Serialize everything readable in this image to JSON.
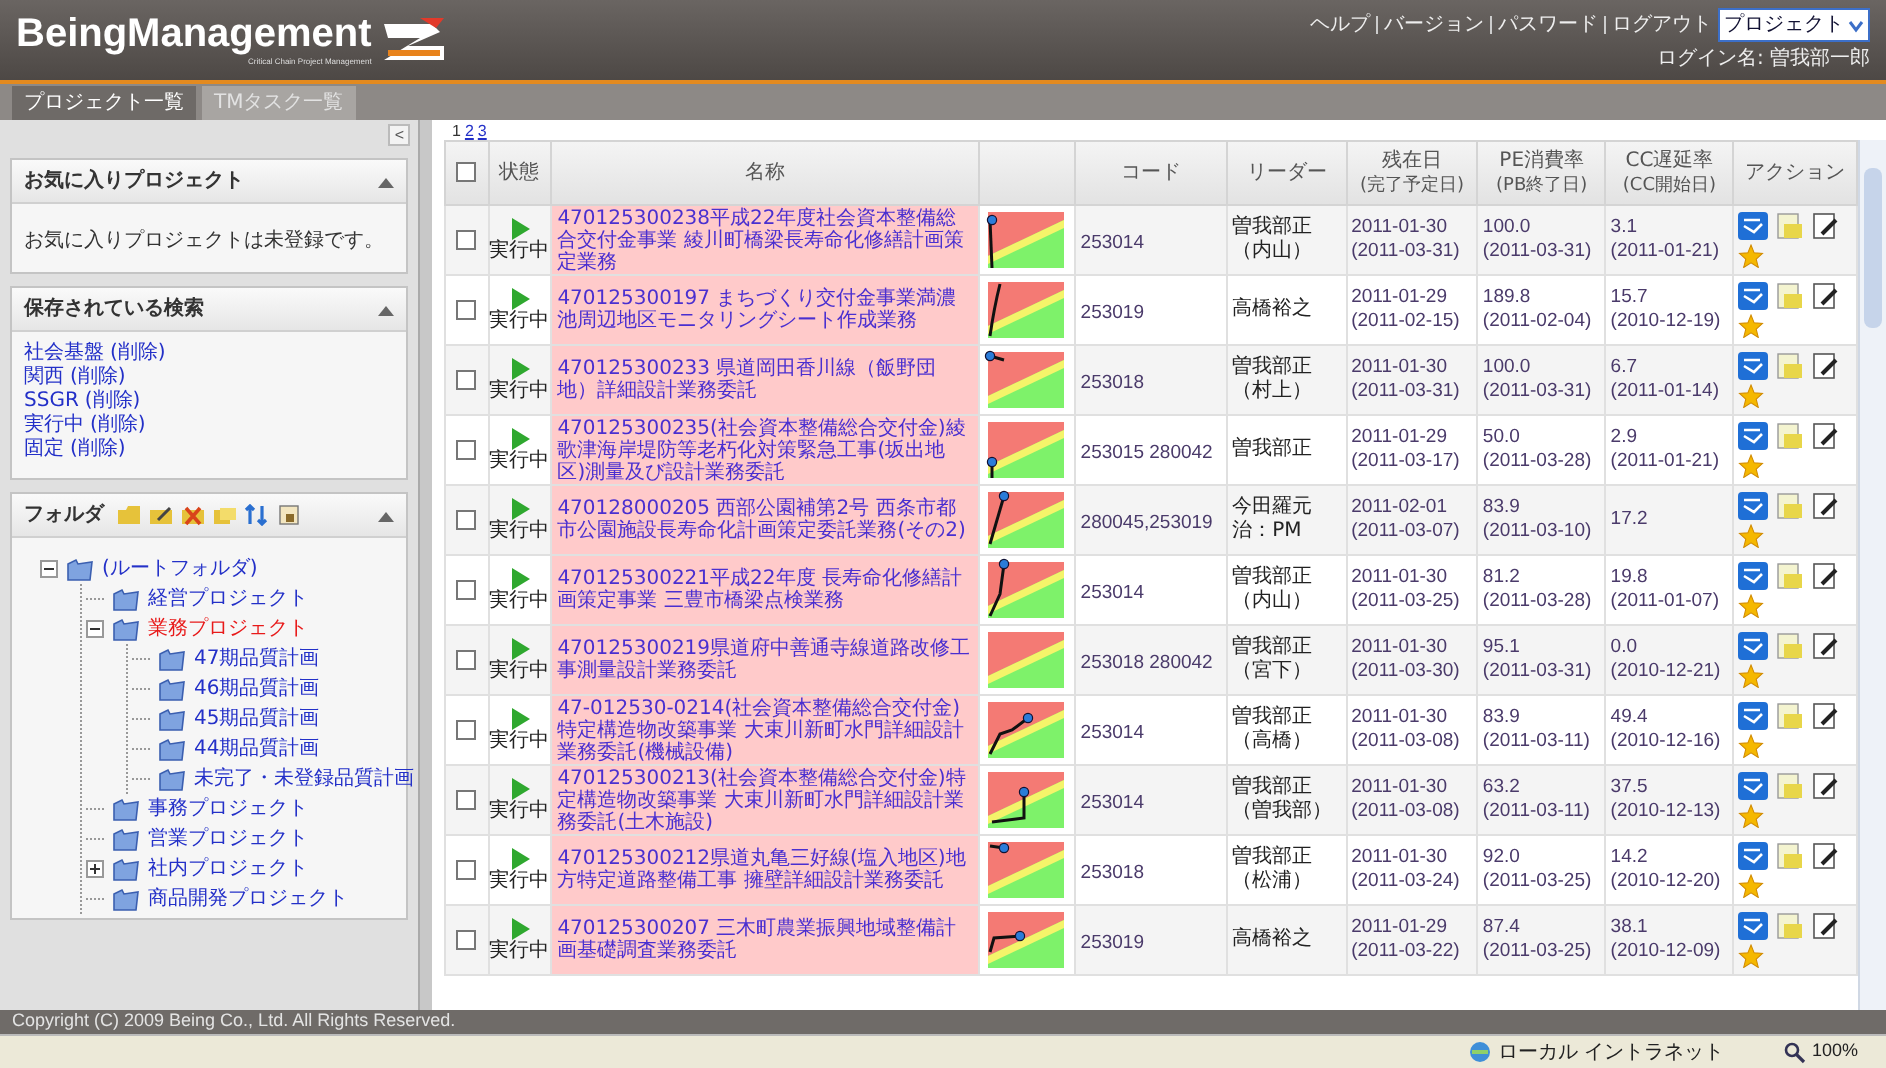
{
  "header": {
    "logo": "BeingManagement",
    "logo_subtitle": "Critical Chain Project Management",
    "links": [
      "ヘルプ",
      "バージョン",
      "パスワード",
      "ログアウト"
    ],
    "project_select": "プロジェクト",
    "login": "ログイン名: 曽我部一郎"
  },
  "tabs": [
    {
      "label": "プロジェクト一覧",
      "selected": true
    },
    {
      "label": "TMタスク一覧",
      "selected": false
    }
  ],
  "sidebar": {
    "collapse": "<",
    "favorites": {
      "title": "お気に入りプロジェクト",
      "message": "お気に入りプロジェクトは未登録です。"
    },
    "saved_searches": {
      "title": "保存されている検索",
      "items": [
        {
          "name": "社会基盤",
          "action": "(削除)"
        },
        {
          "name": "関西",
          "action": "(削除)"
        },
        {
          "name": "SSGR",
          "action": "(削除)"
        },
        {
          "name": "実行中",
          "action": "(削除)"
        },
        {
          "name": "固定",
          "action": "(削除)"
        }
      ]
    },
    "folders": {
      "title": "フォルダ",
      "tree": [
        {
          "label": "(ルートフォルダ)",
          "selected": false,
          "expanded": true,
          "children": [
            {
              "label": "経営プロジェクト",
              "selected": false
            },
            {
              "label": "業務プロジェクト",
              "selected": true,
              "expanded": true,
              "children": [
                {
                  "label": "47期品質計画",
                  "selected": false
                },
                {
                  "label": "46期品質計画",
                  "selected": false
                },
                {
                  "label": "45期品質計画",
                  "selected": false
                },
                {
                  "label": "44期品質計画",
                  "selected": false
                },
                {
                  "label": "未完了・未登録品質計画",
                  "selected": false
                }
              ]
            },
            {
              "label": "事務プロジェクト",
              "selected": false
            },
            {
              "label": "営業プロジェクト",
              "selected": false
            },
            {
              "label": "社内プロジェクト",
              "selected": false,
              "expanded": false
            },
            {
              "label": "商品開発プロジェクト",
              "selected": false
            }
          ]
        }
      ]
    }
  },
  "pagination": [
    {
      "label": "1",
      "selected": true
    },
    {
      "label": "2",
      "selected": false
    },
    {
      "label": "3",
      "selected": false
    }
  ],
  "table": {
    "columns": [
      {
        "kind": "checkbox",
        "checked": false
      },
      {
        "kind": "text",
        "label": "状態"
      },
      {
        "kind": "text",
        "label": "名称"
      },
      {
        "kind": "blank"
      },
      {
        "kind": "text",
        "label": "コード"
      },
      {
        "kind": "text",
        "label": "リーダー"
      },
      {
        "kind": "text",
        "label": "残在日",
        "sublabel": "(完了予定日)"
      },
      {
        "kind": "text",
        "label": "PE消費率",
        "sublabel": "(PB終了日)"
      },
      {
        "kind": "text",
        "label": "CC遅延率",
        "sublabel": "(CC開始日)"
      },
      {
        "kind": "text",
        "label": "アクション"
      }
    ],
    "rows": [
      {
        "checked": false,
        "status": "実行中",
        "name": "470125300238平成22年度社会資本整備総合交付金事業 綾川町橋梁長寿命化修繕計画策定業務",
        "code": "253014",
        "leader": "曽我部正（内山）",
        "date": "2011-01-30",
        "date_sub": "(2011-03-31)",
        "pe": "100.0",
        "pe_sub": "(2011-03-31)",
        "cc": "3.1",
        "cc_sub": "(2011-01-21)"
      },
      {
        "checked": false,
        "status": "実行中",
        "name": "470125300197 まちづくり交付金事業満濃池周辺地区モニタリングシート作成業務",
        "code": "253019",
        "leader": "高橋裕之",
        "date": "2011-01-29",
        "date_sub": "(2011-02-15)",
        "pe": "189.8",
        "pe_sub": "(2011-02-04)",
        "cc": "15.7",
        "cc_sub": "(2010-12-19)"
      },
      {
        "checked": false,
        "status": "実行中",
        "name": "470125300233 県道岡田香川線（飯野団地）詳細設計業務委託",
        "code": "253018",
        "leader": "曽我部正（村上）",
        "date": "2011-01-30",
        "date_sub": "(2011-03-31)",
        "pe": "100.0",
        "pe_sub": "(2011-03-31)",
        "cc": "6.7",
        "cc_sub": "(2011-01-14)"
      },
      {
        "checked": false,
        "status": "実行中",
        "name": "470125300235(社会資本整備総合交付金)綾歌津海岸堤防等老朽化対策緊急工事(坂出地区)測量及び設計業務委託",
        "code": "253015 280042",
        "leader": "曽我部正",
        "date": "2011-01-29",
        "date_sub": "(2011-03-17)",
        "pe": "50.0",
        "pe_sub": "(2011-03-28)",
        "cc": "2.9",
        "cc_sub": "(2011-01-21)"
      },
      {
        "checked": false,
        "status": "実行中",
        "name": "470128000205 西部公園補第2号 西条市都市公園施設長寿命化計画策定委託業務(その2)",
        "code": "280045,253019",
        "leader": "今田羅元治：PM",
        "date": "2011-02-01",
        "date_sub": "(2011-03-07)",
        "pe": "83.9",
        "pe_sub": "(2011-03-10)",
        "cc": "17.2"
      },
      {
        "checked": false,
        "status": "実行中",
        "name": "470125300221平成22年度 長寿命化修繕計画策定事業 三豊市橋梁点検業務",
        "code": "253014",
        "leader": "曽我部正（内山）",
        "date": "2011-01-30",
        "date_sub": "(2011-03-25)",
        "pe": "81.2",
        "pe_sub": "(2011-03-28)",
        "cc": "19.8",
        "cc_sub": "(2011-01-07)"
      },
      {
        "checked": false,
        "status": "実行中",
        "name": "470125300219県道府中善通寺線道路改修工事測量設計業務委託",
        "code": "253018 280042",
        "leader": "曽我部正（宮下）",
        "date": "2011-01-30",
        "date_sub": "(2011-03-30)",
        "pe": "95.1",
        "pe_sub": "(2011-03-31)",
        "cc": "0.0",
        "cc_sub": "(2010-12-21)"
      },
      {
        "checked": false,
        "status": "実行中",
        "name": "47-012530-0214(社会資本整備総合交付金)特定構造物改築事業 大束川新町水門詳細設計業務委託(機械設備)",
        "code": "253014",
        "leader": "曽我部正（高橋）",
        "date": "2011-01-30",
        "date_sub": "(2011-03-08)",
        "pe": "83.9",
        "pe_sub": "(2011-03-11)",
        "cc": "49.4",
        "cc_sub": "(2010-12-16)"
      },
      {
        "checked": false,
        "status": "実行中",
        "name": "470125300213(社会資本整備総合交付金)特定構造物改築事業 大束川新町水門詳細設計業務委託(土木施設)",
        "code": "253014",
        "leader": "曽我部正（曽我部）",
        "date": "2011-01-30",
        "date_sub": "(2011-03-08)",
        "pe": "63.2",
        "pe_sub": "(2011-03-11)",
        "cc": "37.5",
        "cc_sub": "(2010-12-13)"
      },
      {
        "checked": false,
        "status": "実行中",
        "name": "470125300212県道丸亀三好線(塩入地区)地方特定道路整備工事 擁壁詳細設計業務委託",
        "code": "253018",
        "leader": "曽我部正（松浦）",
        "date": "2011-01-30",
        "date_sub": "(2011-03-24)",
        "pe": "92.0",
        "pe_sub": "(2011-03-25)",
        "cc": "14.2",
        "cc_sub": "(2010-12-20)"
      },
      {
        "checked": false,
        "status": "実行中",
        "name": "470125300207 三木町農業振興地域整備計画基礎調査業務委託",
        "code": "253019",
        "leader": "高橋裕之",
        "date": "2011-01-29",
        "date_sub": "(2011-03-22)",
        "pe": "87.4",
        "pe_sub": "(2011-03-25)",
        "cc": "38.1",
        "cc_sub": "(2010-12-09)"
      }
    ]
  },
  "footer": {
    "copyright": "Copyright (C) 2009 Being Co., Ltd. All Rights Reserved."
  },
  "status_bar": {
    "zone": "ローカル イントラネット",
    "zoom": "100%"
  }
}
